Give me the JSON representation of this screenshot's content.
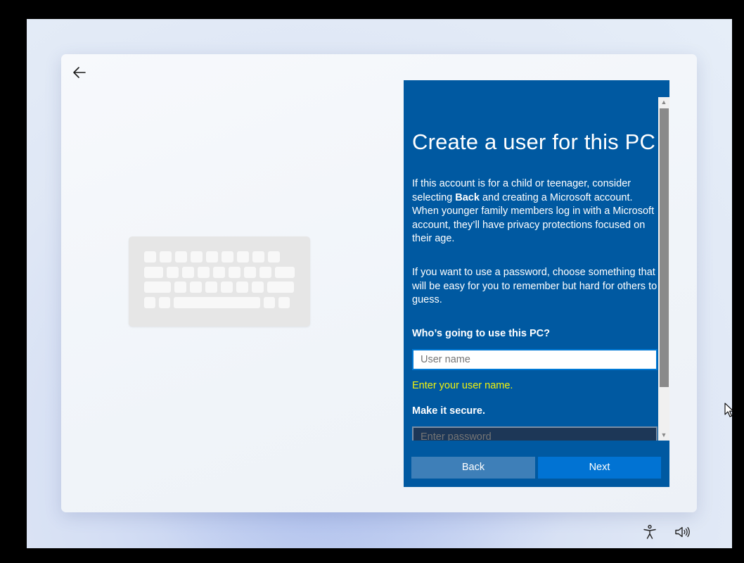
{
  "setup": {
    "title": "Create a user for this PC",
    "intro_before": "If this account is for a child or teenager, consider selecting ",
    "intro_bold": "Back",
    "intro_after": " and creating a Microsoft account. When younger family members log in with a Microsoft account, they’ll have privacy protections focused on their age.",
    "password_note": "If you want to use a password, choose something that will be easy for you to remember but hard for others to guess.",
    "username_label": "Who’s going to use this PC?",
    "username_placeholder": "User name",
    "username_error": "Enter your user name.",
    "secure_label": "Make it secure.",
    "password_placeholder": "Enter password"
  },
  "buttons": {
    "back": "Back",
    "next": "Next"
  },
  "icons": {
    "back": "back-arrow-icon",
    "keyboard": "keyboard-illustration",
    "accessibility": "accessibility-icon",
    "volume": "volume-icon"
  },
  "colors": {
    "panel": "#0059a1",
    "next_button": "#0173d3",
    "back_button": "#3e7fb8",
    "error_text": "#f2f20c"
  }
}
